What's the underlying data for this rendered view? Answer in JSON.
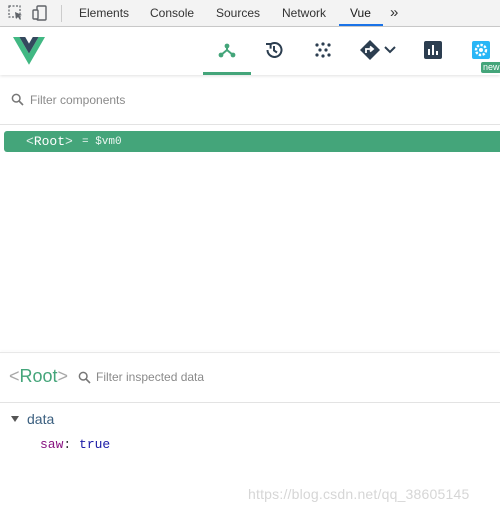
{
  "devtools": {
    "tabs": [
      {
        "label": "Elements",
        "active": false
      },
      {
        "label": "Console",
        "active": false
      },
      {
        "label": "Sources",
        "active": false
      },
      {
        "label": "Network",
        "active": false
      },
      {
        "label": "Vue",
        "active": true
      }
    ],
    "more_label": "»"
  },
  "vue_header": {
    "new_badge": "new",
    "buttons": [
      {
        "name": "components-icon",
        "active": true
      },
      {
        "name": "history-icon",
        "active": false
      },
      {
        "name": "vuex-icon",
        "active": false
      },
      {
        "name": "router-icon",
        "active": false
      },
      {
        "name": "performance-icon",
        "active": false
      },
      {
        "name": "settings-icon",
        "active": false
      }
    ]
  },
  "components_search": {
    "placeholder": "Filter components"
  },
  "tree": {
    "root_open": "<",
    "root_name": "Root",
    "root_close": ">",
    "root_ref": "= $vm0"
  },
  "inspector": {
    "angle_open": "<",
    "component_name": "Root",
    "angle_close": ">",
    "filter_placeholder": "Filter inspected data",
    "section_label": "data",
    "props": [
      {
        "key": "saw",
        "value": "true"
      }
    ]
  },
  "watermark": "https://blog.csdn.net/qq_38605145",
  "colors": {
    "vue_green": "#44a57a",
    "vue_dark": "#34495e",
    "devtools_blue": "#1a73e8"
  }
}
